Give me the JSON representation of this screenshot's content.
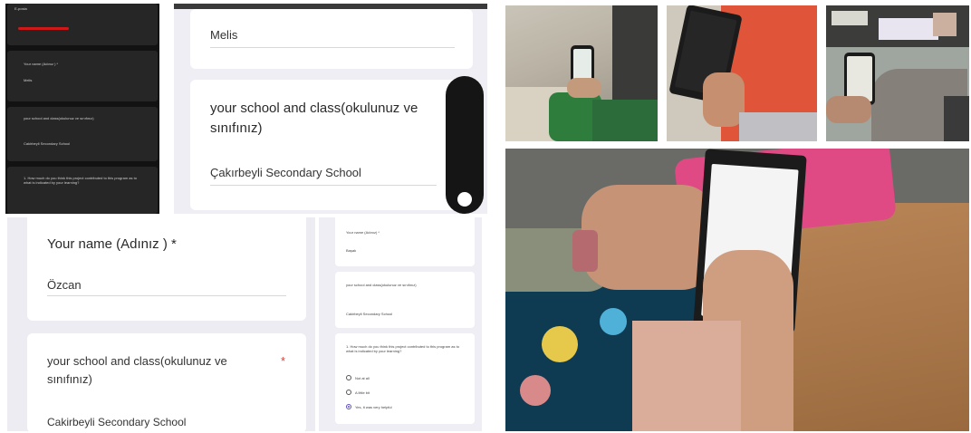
{
  "dark_form": {
    "fields": [
      {
        "label": "E-posta",
        "value": ""
      },
      {
        "label": "Your name (Adınız ) *",
        "value": "Melis"
      },
      {
        "label": "your school and class(okulunuz ve sınıfınız)",
        "value": "Cakirbeyli Secondary School"
      },
      {
        "label": "1. How much do you think this project contributed to this program as to what is indicated by your learning?",
        "value": ""
      }
    ]
  },
  "panel_a": {
    "name_value": "Melis",
    "school_label_line1": "your school and class(okulunuz ve",
    "school_label_line2": "sınıfınız)",
    "school_value": "Çakırbeyli Secondary School"
  },
  "panel_b": {
    "name_label": "Your name (Adınız ) *",
    "name_value": "Özcan",
    "school_label_line1": "your school and class(okulunuz ve",
    "school_label_line2": "sınıfınız)",
    "required_mark": "*",
    "school_value": "Cakirbeyli Secondary School"
  },
  "panel_c": {
    "name_label": "Your name (Adınız) *",
    "name_value": "Başak",
    "school_label": "your school and class(okulunuz ve sınıfınız)",
    "school_value": "Cakirbeyli Secondary School",
    "question": "1. How much do you think this project contributed to this program as to what is indicated by your learning?",
    "options": [
      {
        "label": "Not at all",
        "selected": false
      },
      {
        "label": "A little bit",
        "selected": false
      },
      {
        "label": "Yes, it was very helpful",
        "selected": true
      }
    ]
  },
  "colors": {
    "panel_bg": "#eeeef4",
    "card_bg": "#ffffff",
    "dark_bg": "#121212",
    "accent": "#5b4ec8"
  },
  "photos": [
    {
      "subject": "student holding phone with form, green sleeve"
    },
    {
      "subject": "student holding dark phone, red background"
    },
    {
      "subject": "student with phone over desk and papers"
    },
    {
      "subject": "hands holding phone over floral bag on wooden desk"
    }
  ]
}
